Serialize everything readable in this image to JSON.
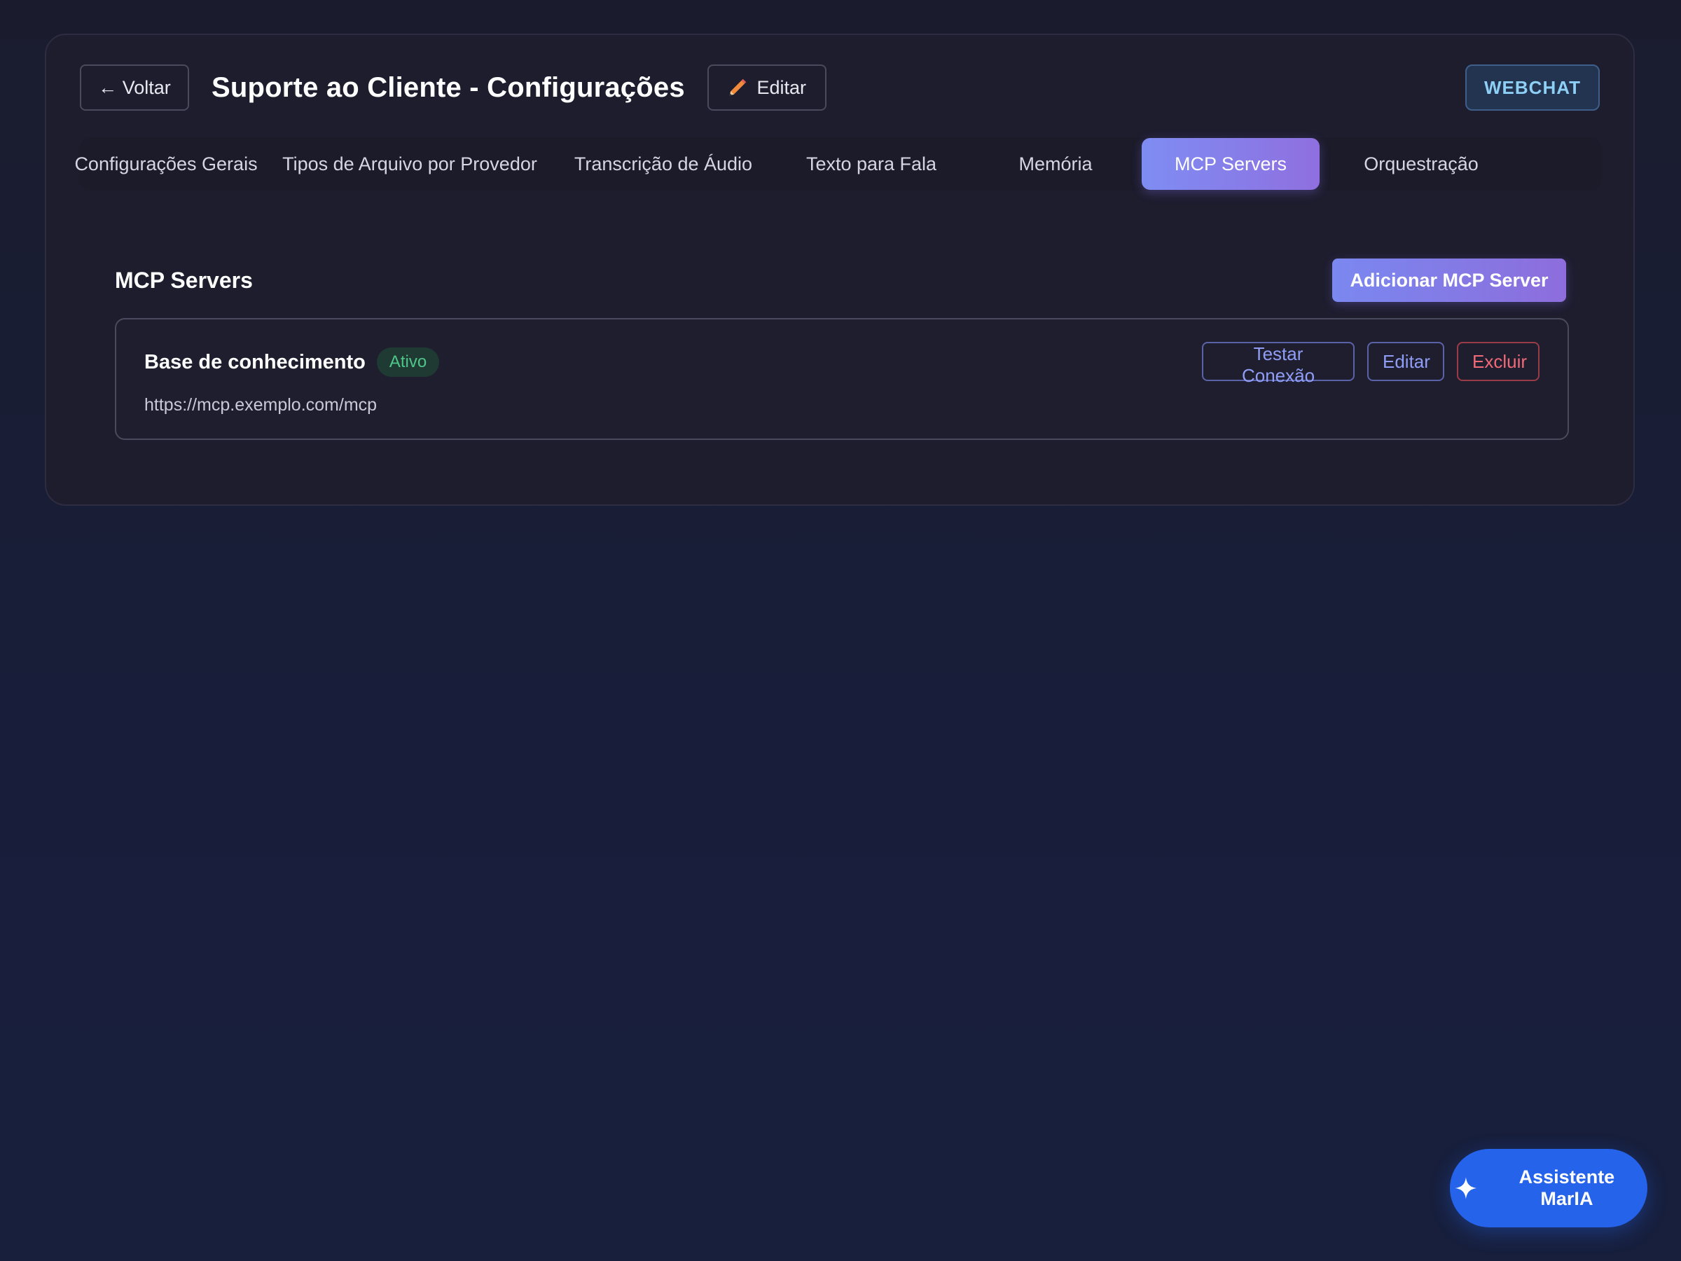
{
  "header": {
    "back_label": "← Voltar",
    "title": "Suporte ao Cliente - Configurações",
    "edit_label": "Editar",
    "channel_badge": "WEBCHAT"
  },
  "tabs": [
    {
      "label": "Configurações Gerais",
      "active": false
    },
    {
      "label": "Tipos de Arquivo por Provedor",
      "active": false
    },
    {
      "label": "Transcrição de Áudio",
      "active": false
    },
    {
      "label": "Texto para Fala",
      "active": false
    },
    {
      "label": "Memória",
      "active": false
    },
    {
      "label": "MCP Servers",
      "active": true
    },
    {
      "label": "Orquestração",
      "active": false
    }
  ],
  "section": {
    "title": "MCP Servers",
    "add_label": "Adicionar MCP Server"
  },
  "servers": [
    {
      "name": "Base de conhecimento",
      "status": "Ativo",
      "url": "https://mcp.exemplo.com/mcp",
      "actions": {
        "test": "Testar Conexão",
        "edit": "Editar",
        "delete": "Excluir"
      }
    }
  ],
  "assistant": {
    "label": "Assistente MarIA"
  },
  "colors": {
    "accent_start": "#7e8df2",
    "accent_end": "#8f6fe0",
    "status_active": "#4fc58a",
    "danger": "#f06a78",
    "assistant_blue": "#2563eb"
  },
  "icons": {
    "edit": "pencil-icon",
    "assistant": "sparkle-icon"
  }
}
